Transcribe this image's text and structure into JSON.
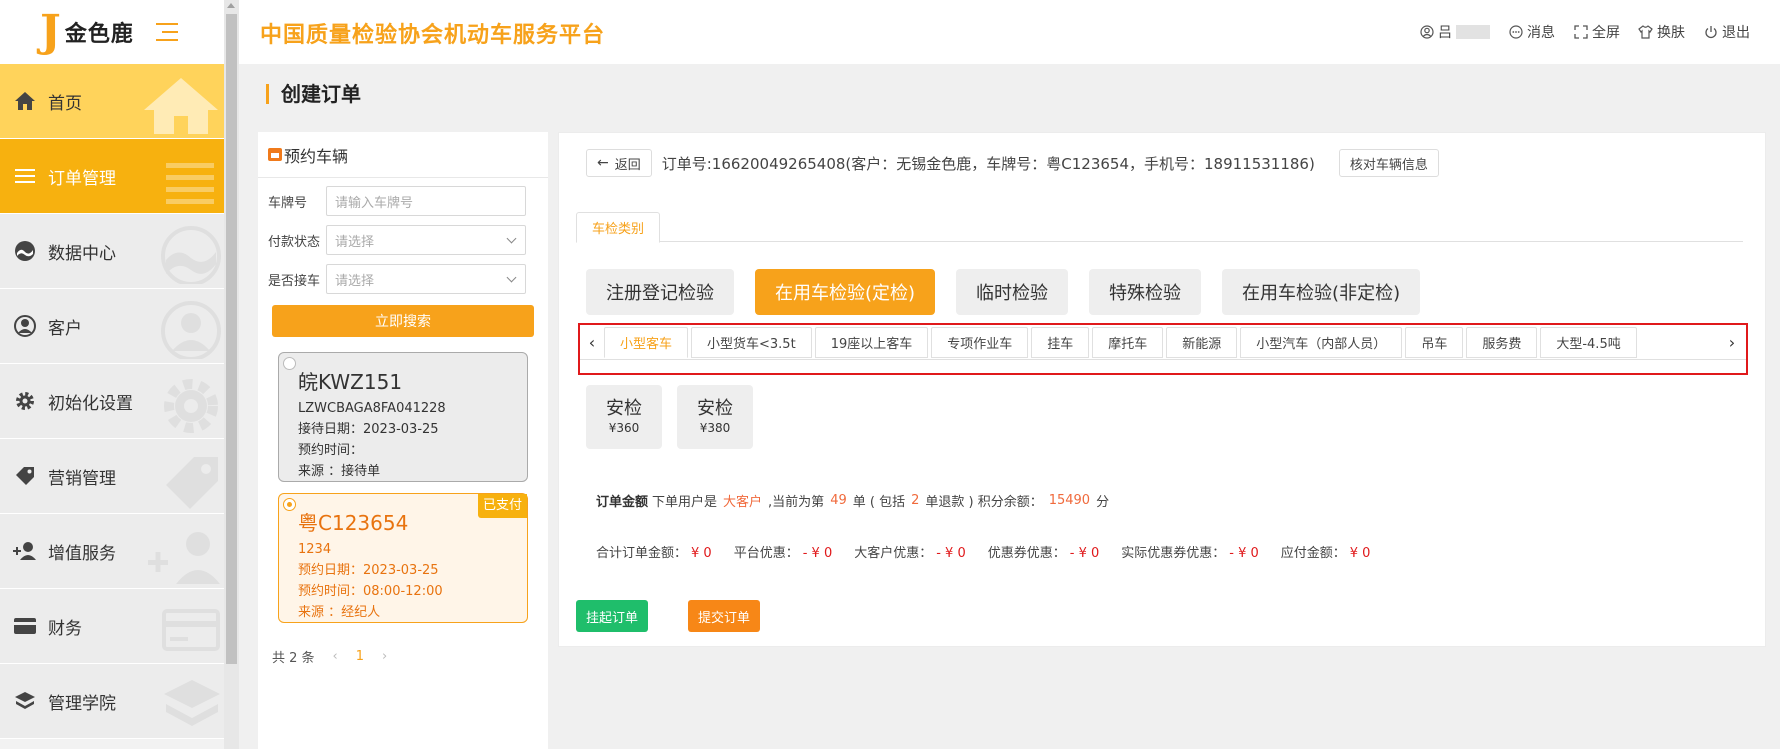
{
  "brand": {
    "logo_mark": "J",
    "logo_text": "金色鹿"
  },
  "sidebar": {
    "items": [
      {
        "label": "首页",
        "icon": "home-icon"
      },
      {
        "label": "订单管理",
        "icon": "list-icon"
      },
      {
        "label": "数据中心",
        "icon": "chart-icon"
      },
      {
        "label": "客户",
        "icon": "user-icon"
      },
      {
        "label": "初始化设置",
        "icon": "gear-icon"
      },
      {
        "label": "营销管理",
        "icon": "tag-icon"
      },
      {
        "label": "增值服务",
        "icon": "add-user-icon"
      },
      {
        "label": "财务",
        "icon": "card-icon"
      },
      {
        "label": "管理学院",
        "icon": "layers-icon"
      }
    ]
  },
  "header": {
    "title": "中国质量检验协会机动车服务平台",
    "user_initial": "吕",
    "messages": "消息",
    "fullscreen": "全屏",
    "skin": "换肤",
    "logout": "退出"
  },
  "page": {
    "title": "创建订单"
  },
  "left_panel": {
    "title": "预约车辆",
    "plate_label": "车牌号",
    "plate_placeholder": "请输入车牌号",
    "pay_label": "付款状态",
    "pay_placeholder": "请选择",
    "pickup_label": "是否接车",
    "pickup_placeholder": "请选择",
    "search_button": "立即搜索",
    "cards": [
      {
        "plate": "皖KWZ151",
        "code": "LZWCBAGA8FA041228",
        "date": "接待日期：2023-03-25",
        "time": "预约时间：",
        "source": "来源 ：接待单"
      },
      {
        "plate": "粤C123654",
        "code": "1234",
        "date": "预约日期：2023-03-25",
        "time": "预约时间：08:00-12:00",
        "source": "来源 ：经纪人",
        "badge": "已支付"
      }
    ],
    "pager": {
      "total": "共 2 条",
      "page": "1",
      "prev": "‹",
      "next": "›"
    }
  },
  "order": {
    "back_button": "返回",
    "info": "订单号:16620049265408(客户：无锡金色鹿，车牌号：粤C123654，手机号：18911531186)",
    "verify_button": "核对车辆信息",
    "tab_label": "车检类别",
    "categories": [
      "注册登记检验",
      "在用车检验(定检)",
      "临时检验",
      "特殊检验",
      "在用车检验(非定检)"
    ],
    "vehicle_types": [
      "小型客车",
      "小型货车<3.5t",
      "19座以上客车",
      "专项作业车",
      "挂车",
      "摩托车",
      "新能源",
      "小型汽车（内部人员）",
      "吊车",
      "服务费",
      "大型-4.5吨"
    ],
    "services": [
      {
        "name": "安检",
        "price": "¥360"
      },
      {
        "name": "安检",
        "price": "¥380"
      }
    ],
    "summary": {
      "label": "订单金额",
      "text1": "下单用户是",
      "customer_type": "大客户",
      "text2": ",当前为第",
      "order_count": "49",
      "text3": "单 ( 包括",
      "refund_count": "2",
      "text4": "单退款 ) 积分余额：",
      "points": "15490",
      "text5": "分"
    },
    "amounts": [
      {
        "label": "合计订单金额：",
        "value": "¥ 0"
      },
      {
        "label": "平台优惠：",
        "value": "- ¥ 0"
      },
      {
        "label": "大客户优惠：",
        "value": "- ¥ 0"
      },
      {
        "label": "优惠券优惠：",
        "value": "- ¥ 0"
      },
      {
        "label": "实际优惠券优惠：",
        "value": "- ¥ 0"
      },
      {
        "label": "应付金额：",
        "value": "¥ 0"
      }
    ],
    "hold_button": "挂起订单",
    "submit_button": "提交订单"
  },
  "colors": {
    "accent": "#f7a21b",
    "highlight_border": "#e0191b",
    "green": "#1fbe6b"
  }
}
